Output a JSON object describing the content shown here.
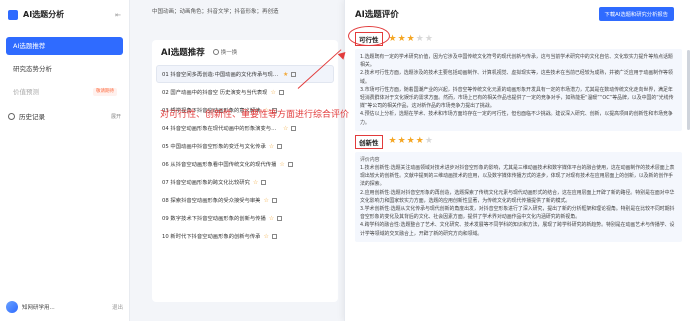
{
  "app": {
    "title": "AI选题分析"
  },
  "sidebar": {
    "items": [
      {
        "label": "AI选题推荐",
        "active": true
      },
      {
        "label": "研究态势分析",
        "active": false
      },
      {
        "label": "价值预测",
        "badge": "敬请期待"
      }
    ],
    "history_label": "历史记录",
    "expand_label": "展开",
    "user_name": "知网研学用...",
    "logout_label": "退出"
  },
  "topbar": {
    "text": "中国动画；动画角色；抖音文学；抖音形象；再创造"
  },
  "main": {
    "title": "AI选题推荐",
    "swap_label": "换一换",
    "topics": [
      "01 抖音空间多再创造:中国动画的文化传承与现代创新",
      "02 国产动画中的抖音空 历史演变与当代表现",
      "03 哲学视角下抖音空动画形象的意义解读",
      "04 抖音空动画形象在现代动画中的形象演变与产业价值",
      "05 中国动画中抖音空形象的变迁与文化传承",
      "06 从抖音空动画形象看中国传统文化的现代传播",
      "07 抖音空动画形象的跨文化比较研究",
      "08 探索抖音空动画形象的受众接受与审美",
      "09 数字技术下抖音空动画形象的创新与传播",
      "10 新时代下抖音空动画形象的创新与传承"
    ]
  },
  "annotation": {
    "text": "对可行性、创新性、重要性等方面进行综合评价"
  },
  "panel": {
    "title": "AI选题评价",
    "export_label": "下载AI选题和研究分析报告",
    "sections": [
      {
        "label": "可行性",
        "stars": 3,
        "paragraphs": [
          "1.选题既有一定的学术研究价值，因为它涉及中国传统文化符号的现代创新与传承，这与当前学术研究中的文化自信、文化软实力提升等热点话题相关。",
          "2.技术可行性方面，选题涉及的技术主要包括动画制作、计算机视觉、虚拟现实等，这些技术在当前已经较为成熟，并被广泛应用于动画制作等领域。",
          "3.市场可行性方面，随着国潮产业的兴起，抖音空等传统文化元素的动画形象开发具有一定的市场潜力，尤其是在数动传统文化走向世界，满足年轻消费群体对于文化娱乐的需求方面。然而，市场上已有的相关作品也提供了一定的竞争对手，如熟能拒“温暖”“OC”等品牌，以及中国的“光线传媒”等公司的相关作品，这对新作品的市场竞争力提出了挑战。",
          "4.预估以上分析，选题在学术、技术和市场方面均存在一定的可行性，但也面临不少挑战。建议深入研究、创新，以提高项目的创新性和市场竞争力。"
        ]
      },
      {
        "label": "创新性",
        "stars": 4,
        "paragraphs": [
          "评价内容",
          "1.技术创新性:选题关注动画领域对技术进步对抖音空形象的影响，尤其是三维动画技术和数字媒体平台的融合使用，这在动画制作的技术层面上表现出较大的创新性。文献中提到的三维动画技术的应用，以及数字媒体传播方式的进步，体现了对现有技术在应用层面上的创新，以及新的创作手法的探索。",
          "2.应用创新性:选题对抖音空形象的再创造，选题探索了传统文化元素与现代动画形式的结合，这在应用层面上开辟了新的路径。特别是在面对中华文化影响力和国家软实力方面，选题的应用创新性显著，为传统文化的现代传播提供了新的模式。",
          "3.学术创新性:选题从文化传承与现代创新的角度出发，对抖音空形象进行了深入研究，提出了新的分析框架和理论视角。特别是在比较不同时期抖音空形象的变化及其背后的文化、社会因素方面，提供了学术界对动画作品中文化内涵研究的新视角。",
          "4.跨学科的融合性:选题整合了艺术、文化研究、技术发展等不同学科的知识和方法，展现了跨学科研究的新趋势。特别是在动画艺术与传播学、设计学等领域的交叉融合上，开辟了新的研究方向和领域。"
        ]
      }
    ]
  },
  "colors": {
    "accent": "#2f6bff",
    "annotation": "#e23b3b",
    "star_on": "#f5a623",
    "star_off": "#d8d8d8"
  }
}
